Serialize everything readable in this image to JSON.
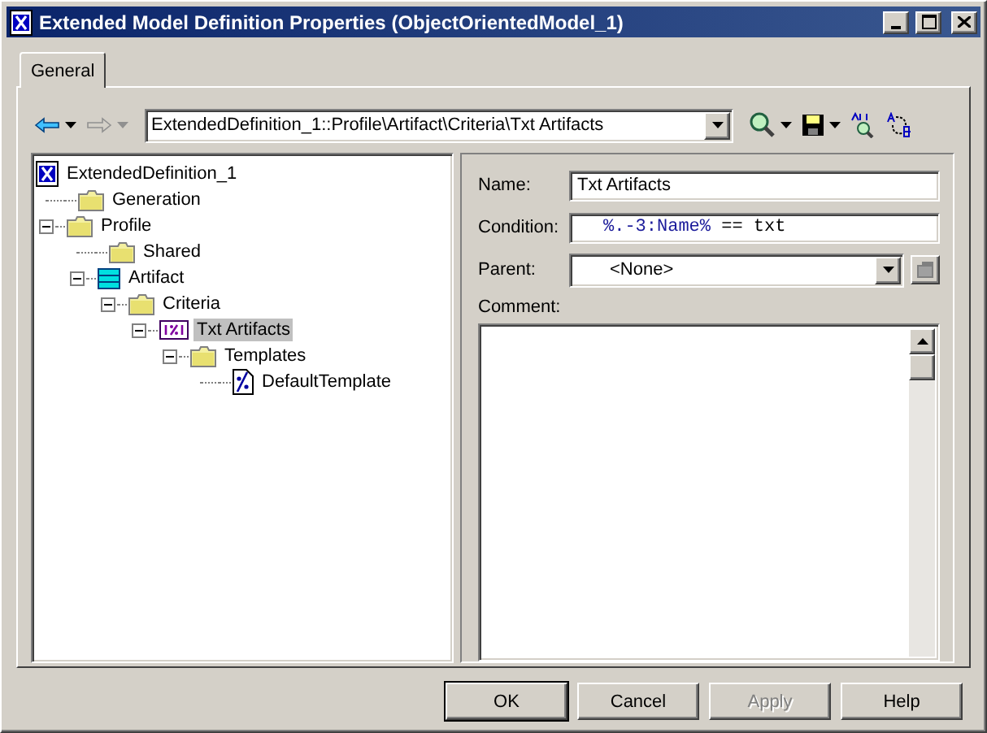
{
  "window": {
    "title": "Extended Model Definition Properties (ObjectOrientedModel_1)"
  },
  "tabs": [
    {
      "label": "General",
      "selected": true
    }
  ],
  "toolbar": {
    "back_disabled": false,
    "forward_disabled": true,
    "path": "ExtendedDefinition_1::Profile\\Artifact\\Criteria\\Txt Artifacts"
  },
  "tree": [
    {
      "label": "ExtendedDefinition_1",
      "kind": "model",
      "selected": false,
      "children": [
        {
          "label": "Generation",
          "kind": "folder",
          "selected": false
        },
        {
          "label": "Profile",
          "kind": "folder",
          "selected": false,
          "expanded": true,
          "children": [
            {
              "label": "Shared",
              "kind": "folder",
              "selected": false
            },
            {
              "label": "Artifact",
              "kind": "artifact",
              "selected": false,
              "expanded": true,
              "children": [
                {
                  "label": "Criteria",
                  "kind": "folder",
                  "selected": false,
                  "expanded": true,
                  "children": [
                    {
                      "label": "Txt Artifacts",
                      "kind": "criteria",
                      "selected": true,
                      "expanded": true,
                      "children": [
                        {
                          "label": "Templates",
                          "kind": "folder",
                          "selected": false,
                          "expanded": true,
                          "children": [
                            {
                              "label": "DefaultTemplate",
                              "kind": "template",
                              "selected": false
                            }
                          ]
                        }
                      ]
                    }
                  ]
                }
              ]
            }
          ]
        }
      ]
    }
  ],
  "form": {
    "name_label": "Name:",
    "name_value": "Txt Artifacts",
    "condition_label": "Condition:",
    "condition": [
      {
        "text": "%.-3:Name%",
        "kind": "macro"
      },
      {
        "text": " == txt",
        "kind": "plain"
      }
    ],
    "parent_label": "Parent:",
    "parent_value": "<None>",
    "comment_label": "Comment:"
  },
  "buttons": [
    {
      "label": "OK",
      "default": true,
      "disabled": false
    },
    {
      "label": "Cancel",
      "default": false,
      "disabled": false
    },
    {
      "label": "Apply",
      "default": false,
      "disabled": true
    },
    {
      "label": "Help",
      "default": false,
      "disabled": false
    }
  ]
}
